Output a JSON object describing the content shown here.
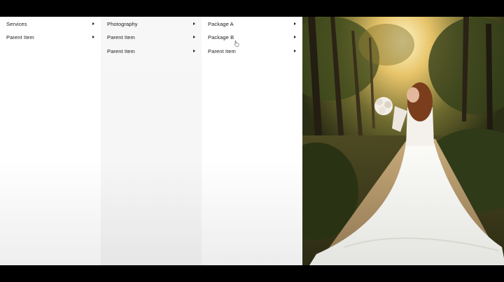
{
  "menu": {
    "column1": [
      {
        "label": "Services"
      },
      {
        "label": "Parent Item"
      }
    ],
    "column2": [
      {
        "label": "Photography"
      },
      {
        "label": "Parent Item"
      },
      {
        "label": "Parent Item"
      }
    ],
    "column3": [
      {
        "label": "Package A"
      },
      {
        "label": "Package B"
      },
      {
        "label": "Parent Item"
      }
    ]
  },
  "icons": {
    "submenu": "caret-right-icon",
    "cursor": "hand-pointer-icon"
  },
  "colors": {
    "menu_bg": "#ffffff",
    "menu_active_bg": "#f6f6f6",
    "text": "#1a1a1a",
    "letterbox": "#000000"
  }
}
